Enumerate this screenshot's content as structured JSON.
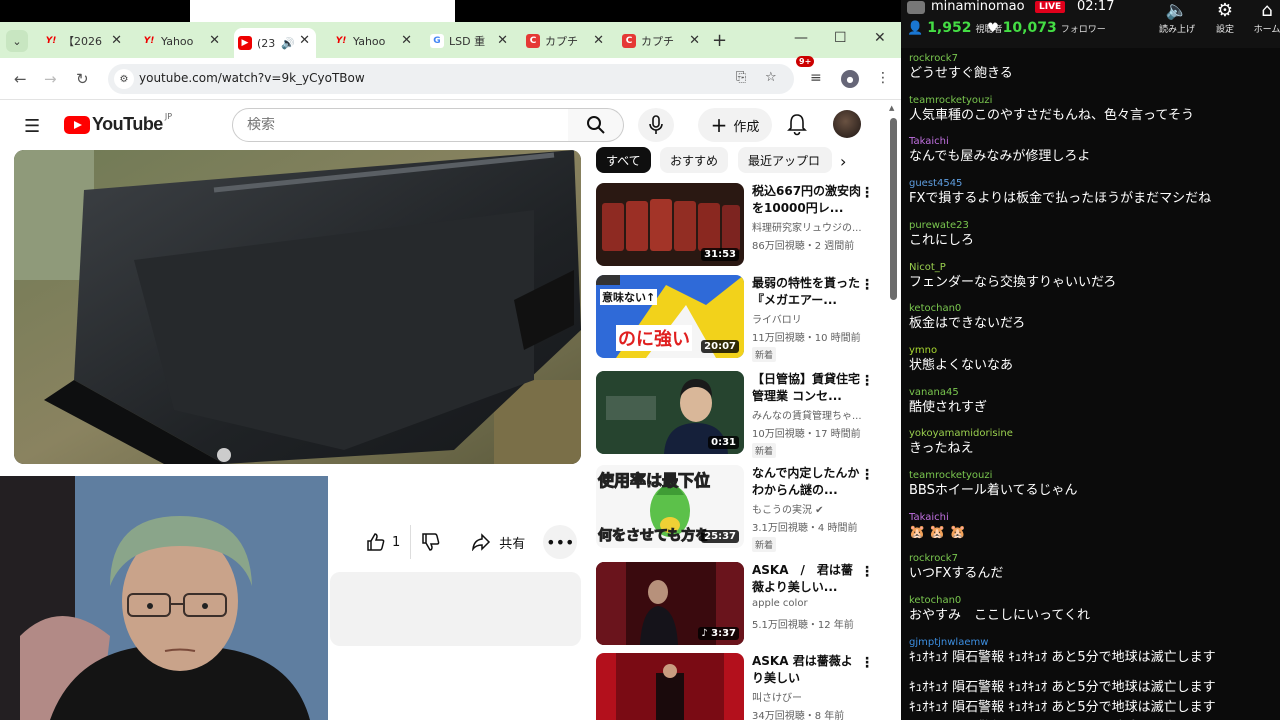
{
  "browser": {
    "tabs": [
      {
        "title": "【2026",
        "fav": "Y!",
        "fav_class": "fav-y"
      },
      {
        "title": "Yahoo",
        "fav": "Y!",
        "fav_class": "fav-y"
      },
      {
        "title": "(23",
        "fav": "▶",
        "fav_class": "fav-yt",
        "active": true
      },
      {
        "title": "Yahoo",
        "fav": "Y!",
        "fav_class": "fav-y"
      },
      {
        "title": "LSD 重",
        "fav": "G",
        "fav_class": "fav-g"
      },
      {
        "title": "カプチ",
        "fav": "C",
        "fav_class": "fav-c"
      },
      {
        "title": "カプチ",
        "fav": "C",
        "fav_class": "fav-c"
      }
    ],
    "url": "youtube.com/watch?v=9k_yCyoTBow"
  },
  "youtube": {
    "logo_text": "YouTube",
    "logo_region": "JP",
    "search_placeholder": "検索",
    "create_label": "作成",
    "notif_badge": "9+",
    "chips": [
      "すべて",
      "おすすめ",
      "最近アップロ"
    ],
    "like_count": "1",
    "share_label": "共有",
    "recommendations": [
      {
        "title": "税込667円の激安肉を10000円レ...",
        "channel": "料理研究家リュウジの...",
        "meta": "86万回視聴・2 週間前",
        "duration": "31:53",
        "new": ""
      },
      {
        "title": "最弱の特性を貰った『メガエアー...",
        "channel": "ライバロリ",
        "meta": "11万回視聴・10 時間前",
        "duration": "20:07",
        "new": "新着"
      },
      {
        "title": "【日管協】賃貸住宅管理業 コンセ...",
        "channel": "みんなの賃貸管理ちゃ...",
        "meta": "10万回視聴・17 時間前",
        "duration": "0:31",
        "new": "新着"
      },
      {
        "title": "なんで内定したんかわからん謎の...",
        "channel": "もこうの実況 ✔",
        "meta": "3.1万回視聴・4 時間前",
        "duration": "25:37",
        "new": "新着"
      },
      {
        "title": "ASKA　/　君は薔薇より美しい...",
        "channel": "apple color",
        "meta": "5.1万回視聴・12 年前",
        "duration": "♪ 3:37",
        "new": ""
      },
      {
        "title": "ASKA 君は薔薇より美しい",
        "channel": "叫さけびー",
        "meta": "34万回視聴・8 年前",
        "duration": "",
        "new": ""
      }
    ],
    "thumb_texts": {
      "t2_left": "意味ない↑",
      "t2_big": "のに強い",
      "t4_top": "使用率は最下位",
      "t4_bottom": "何をさせても方を"
    }
  },
  "stream": {
    "streamer": "minaminomao",
    "live_label": "LIVE",
    "timer": "02:17",
    "viewers": "1,952",
    "viewers_label": "視聴者",
    "followers": "10,073",
    "followers_label": "フォロワー",
    "buttons": [
      {
        "label": "読み上げ",
        "icon": "🔈"
      },
      {
        "label": "設定",
        "icon": "⚙"
      },
      {
        "label": "ホーム",
        "icon": "⌂"
      }
    ]
  },
  "chat": [
    {
      "user": "rockrock7",
      "text": "どうせすぐ飽きる",
      "color": "#7ac74f"
    },
    {
      "user": "teamrocketyouzi",
      "text": "人気車種のこのやすさだもんね、色々言ってそう",
      "color": "#7ac74f"
    },
    {
      "user": "Takaichi",
      "text": "なんでも屋みなみが修理しろよ",
      "color": "#c070e0"
    },
    {
      "user": "guest4545",
      "text": "FXで損するよりは板金で払ったほうがまだマシだね",
      "color": "#5f9ee0"
    },
    {
      "user": "purewate23",
      "text": "これにしろ",
      "color": "#7ac74f"
    },
    {
      "user": "Nicot_P",
      "text": "フェンダーなら交換すりゃいいだろ",
      "color": "#9ad04f"
    },
    {
      "user": "ketochan0",
      "text": "板金はできないだろ",
      "color": "#7ac74f"
    },
    {
      "user": "ymno",
      "text": "状態よくないなあ",
      "color": "#a8d830"
    },
    {
      "user": "vanana45",
      "text": "酷使されすぎ",
      "color": "#7ac74f"
    },
    {
      "user": "yokoyamamidorisine",
      "text": "きったねえ",
      "color": "#9ad04f"
    },
    {
      "user": "teamrocketyouzi",
      "text": "BBSホイール着いてるじゃん",
      "color": "#7ac74f"
    },
    {
      "user": "Takaichi",
      "text": "🐹 🐹 🐹",
      "color": "#c070e0"
    },
    {
      "user": "rockrock7",
      "text": "いつFXするんだ",
      "color": "#7ac74f"
    },
    {
      "user": "ketochan0",
      "text": "おやすみ　ここしにいってくれ",
      "color": "#7ac74f"
    },
    {
      "user": "gjmptjnwlaemw",
      "text": "ｷｭｵｷｭｵ 隕石警報 ｷｭｵｷｭｵ あと5分で地球は滅亡します",
      "color": "#3c8ee0"
    },
    {
      "user": "",
      "text": "ｷｭｵｷｭｵ 隕石警報 ｷｭｵｷｭｵ あと5分で地球は滅亡します",
      "color": "#3c8ee0"
    },
    {
      "user": "",
      "text": "ｷｭｵｷｭｵ 隕石警報 ｷｭｵｷｭｵ あと5分で地球は滅亡します",
      "color": "#3c8ee0"
    },
    {
      "user": "",
      "text": "ｷｭｵｷｭｵ 隕石警報 ｷｭｵｷｭｵ あと5分で地球は滅亡します",
      "color": "#3c8ee0"
    }
  ]
}
